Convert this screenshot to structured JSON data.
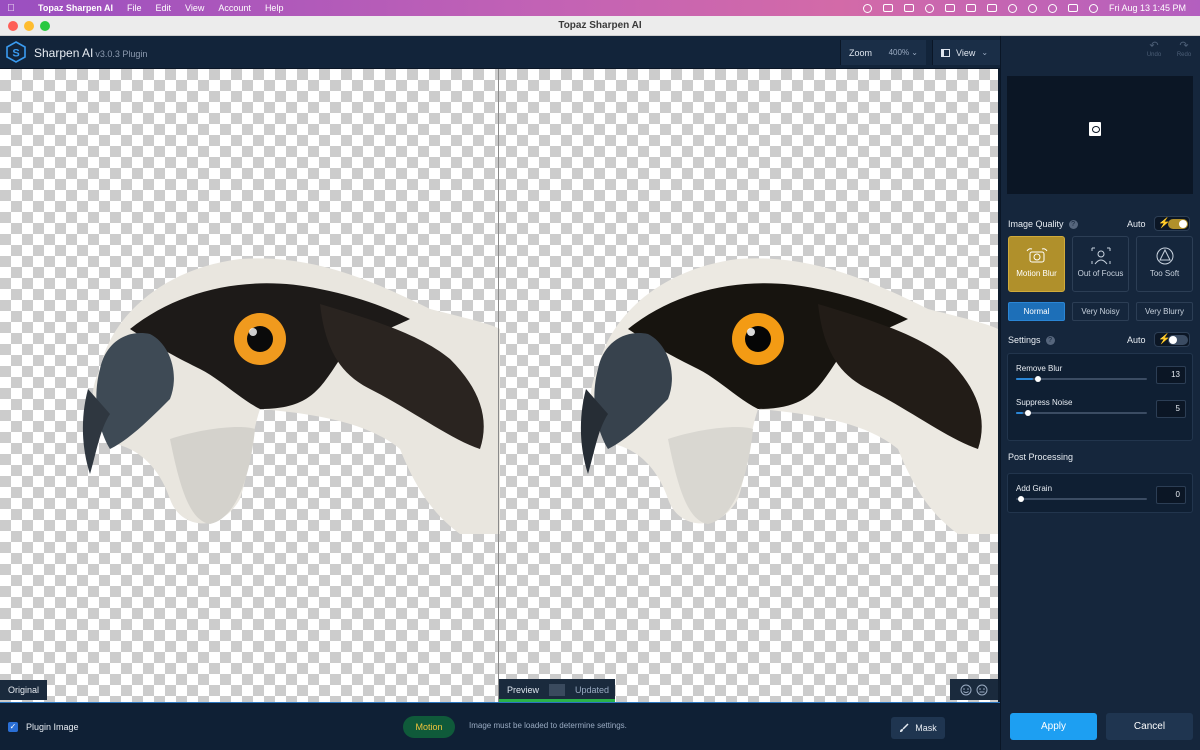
{
  "menubar": {
    "app_name": "Topaz Sharpen AI",
    "menus": [
      "File",
      "Edit",
      "View",
      "Account",
      "Help"
    ],
    "clock": "Fri Aug 13  1:45 PM"
  },
  "window": {
    "title": "Topaz Sharpen AI"
  },
  "header": {
    "app_name": "Sharpen AI",
    "version": "v3.0.3 Plugin",
    "zoom_label": "Zoom",
    "zoom_value": "400%",
    "view_label": "View"
  },
  "canvas": {
    "original_label": "Original",
    "preview_label": "Preview",
    "updated_label": "Updated"
  },
  "bottom_bar": {
    "plugin_image_label": "Plugin Image",
    "plugin_image_checked": true,
    "motion_label": "Motion",
    "message": "Image must be loaded to determine settings.",
    "mask_label": "Mask"
  },
  "panel": {
    "undo_label": "Undo",
    "redo_label": "Redo",
    "image_quality": {
      "label": "Image Quality",
      "auto_label": "Auto",
      "auto_on": true,
      "modes": [
        {
          "label": "Motion Blur",
          "icon": "motion-blur-icon",
          "active": true
        },
        {
          "label": "Out of Focus",
          "icon": "out-of-focus-icon",
          "active": false
        },
        {
          "label": "Too Soft",
          "icon": "too-soft-icon",
          "active": false
        }
      ],
      "noise_levels": [
        {
          "label": "Normal",
          "active": true
        },
        {
          "label": "Very Noisy",
          "active": false
        },
        {
          "label": "Very Blurry",
          "active": false
        }
      ]
    },
    "settings": {
      "label": "Settings",
      "auto_label": "Auto",
      "auto_on": false,
      "remove_blur": {
        "label": "Remove Blur",
        "value": "13",
        "level": 0.13
      },
      "suppress_noise": {
        "label": "Suppress Noise",
        "value": "5",
        "level": 0.05
      }
    },
    "post_processing": {
      "label": "Post Processing",
      "add_grain": {
        "label": "Add Grain",
        "value": "0",
        "level": 0
      }
    },
    "apply_label": "Apply",
    "cancel_label": "Cancel"
  },
  "colors": {
    "accent_blue": "#1d9ff2",
    "active_gold": "#b0902b",
    "panel_bg": "#15263c",
    "motion_pill_text": "#f0c43c"
  }
}
